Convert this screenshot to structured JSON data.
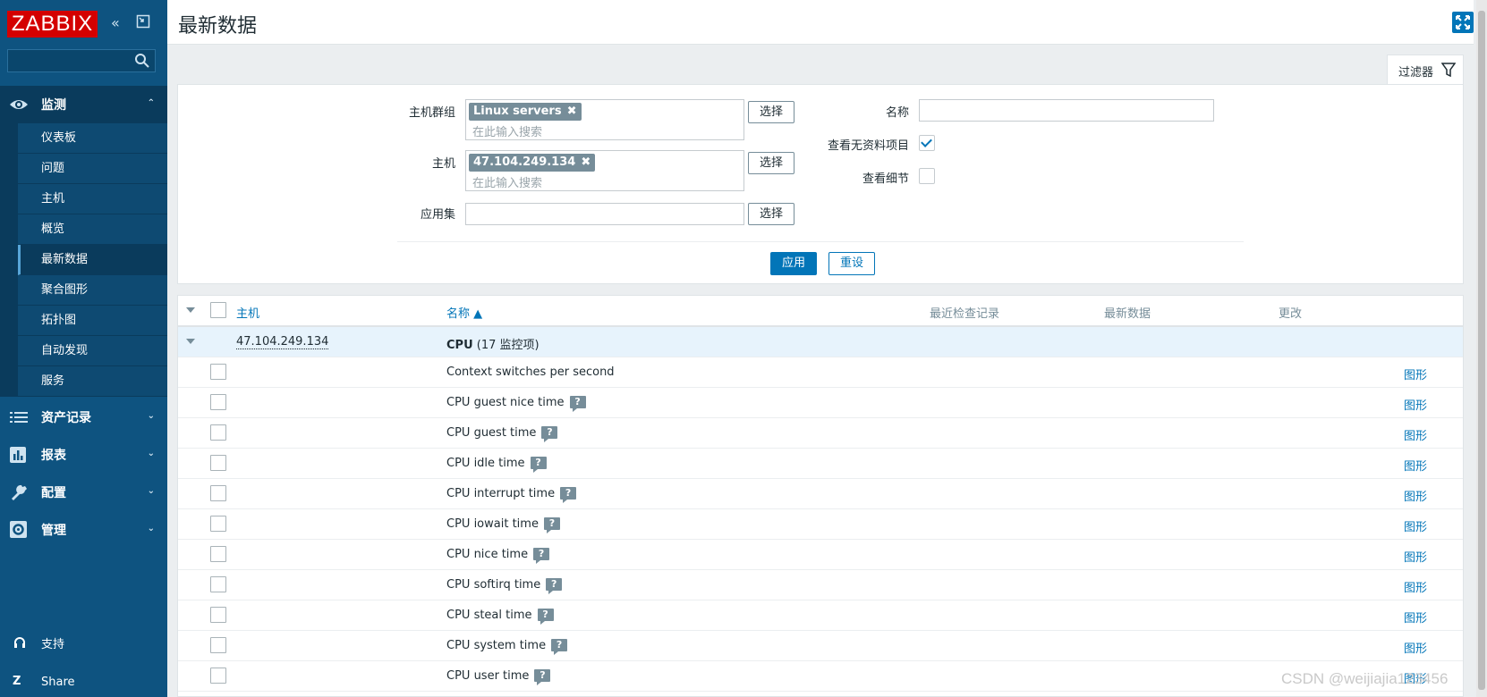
{
  "app": {
    "logo": "ZABBIX",
    "page_title": "最新数据"
  },
  "sidebar": {
    "sections": [
      {
        "label": "监测",
        "icon": "eye-icon",
        "expanded": true
      },
      {
        "label": "资产记录",
        "icon": "list-icon",
        "expanded": false
      },
      {
        "label": "报表",
        "icon": "bar-chart-icon",
        "expanded": false
      },
      {
        "label": "配置",
        "icon": "wrench-icon",
        "expanded": false
      },
      {
        "label": "管理",
        "icon": "gear-icon",
        "expanded": false
      }
    ],
    "monitoring_items": [
      "仪表板",
      "问题",
      "主机",
      "概览",
      "最新数据",
      "聚合图形",
      "拓扑图",
      "自动发现",
      "服务"
    ],
    "selected_item": "最新数据",
    "support_label": "支持",
    "share_label": "Share",
    "share_icon_text": "Z"
  },
  "filter": {
    "tab_label": "过滤器",
    "host_group_label": "主机群组",
    "host_group_tag": "Linux servers",
    "host_label": "主机",
    "host_tag": "47.104.249.134",
    "placeholder": "在此输入搜索",
    "application_label": "应用集",
    "application_value": "",
    "select_label": "选择",
    "name_label": "名称",
    "name_value": "",
    "show_items_without_data_label": "查看无资料项目",
    "show_items_without_data": true,
    "show_details_label": "查看细节",
    "show_details": false,
    "apply_label": "应用",
    "reset_label": "重设"
  },
  "table": {
    "headers": {
      "host": "主机",
      "name": "名称 ▲",
      "last_check": "最近检查记录",
      "last_value": "最新数据",
      "change": "更改"
    },
    "group": {
      "host": "47.104.249.134",
      "app_name": "CPU",
      "app_count": "(17 监控项)"
    },
    "graph_label": "图形",
    "help_glyph": "?",
    "rows": [
      {
        "name": "Context switches per second",
        "help": false
      },
      {
        "name": "CPU guest nice time",
        "help": true
      },
      {
        "name": "CPU guest time",
        "help": true
      },
      {
        "name": "CPU idle time",
        "help": true
      },
      {
        "name": "CPU interrupt time",
        "help": true
      },
      {
        "name": "CPU iowait time",
        "help": true
      },
      {
        "name": "CPU nice time",
        "help": true
      },
      {
        "name": "CPU softirq time",
        "help": true
      },
      {
        "name": "CPU steal time",
        "help": true
      },
      {
        "name": "CPU system time",
        "help": true
      },
      {
        "name": "CPU user time",
        "help": true
      }
    ]
  },
  "watermark": "CSDN @weijiajia123456",
  "colors": {
    "sidebar_bg": "#0e5380",
    "logo_red": "#d40000",
    "link_blue": "#0275b8",
    "tag_gray": "#768d99"
  }
}
